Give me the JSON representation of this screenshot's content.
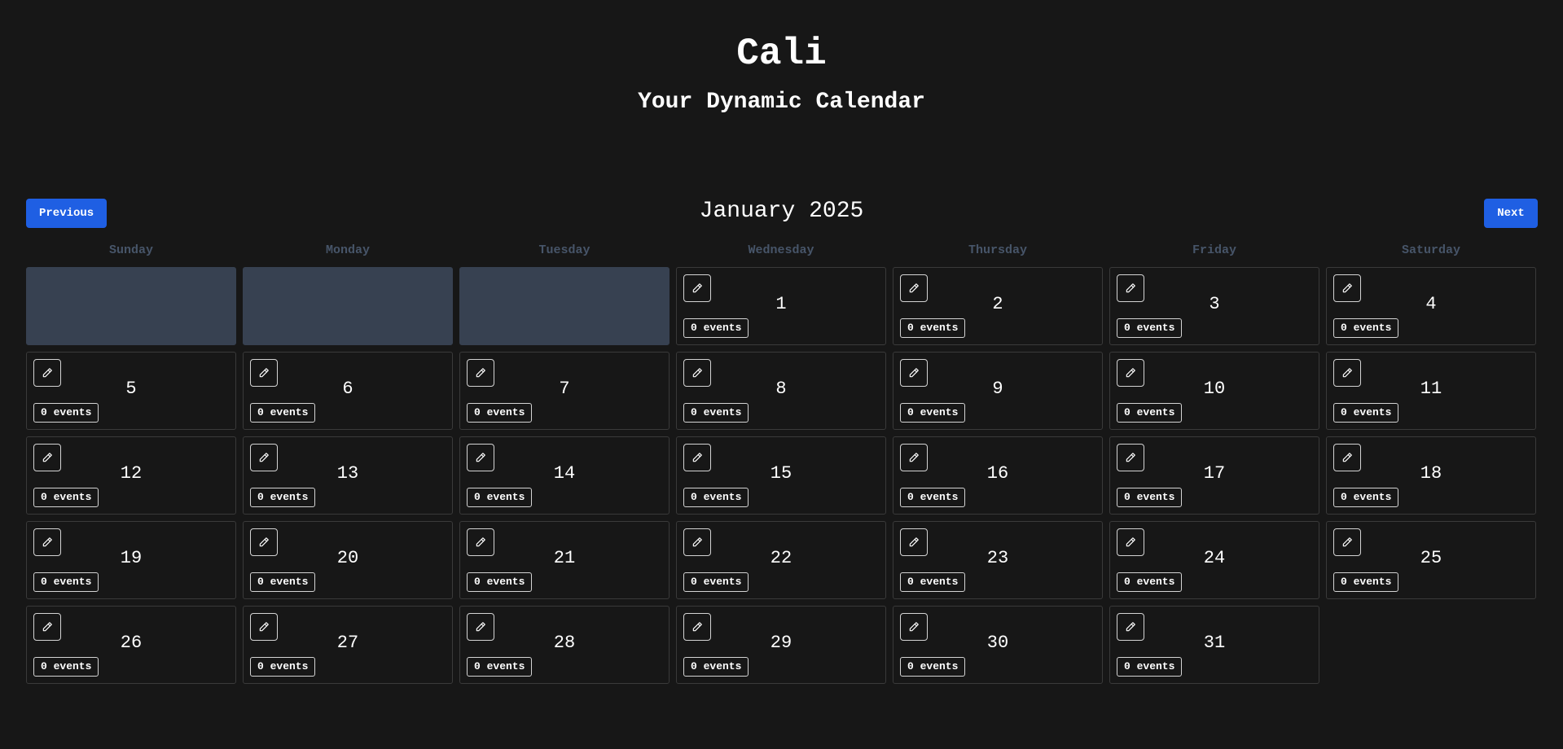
{
  "header": {
    "title": "Cali",
    "subtitle": "Your Dynamic Calendar"
  },
  "nav": {
    "previous_label": "Previous",
    "next_label": "Next",
    "month_title": "January 2025"
  },
  "weekdays": [
    "Sunday",
    "Monday",
    "Tuesday",
    "Wednesday",
    "Thursday",
    "Friday",
    "Saturday"
  ],
  "calendar": {
    "leading_blank_days": 3,
    "days": [
      {
        "day": "1",
        "events": "0 events"
      },
      {
        "day": "2",
        "events": "0 events"
      },
      {
        "day": "3",
        "events": "0 events"
      },
      {
        "day": "4",
        "events": "0 events"
      },
      {
        "day": "5",
        "events": "0 events"
      },
      {
        "day": "6",
        "events": "0 events"
      },
      {
        "day": "7",
        "events": "0 events"
      },
      {
        "day": "8",
        "events": "0 events"
      },
      {
        "day": "9",
        "events": "0 events"
      },
      {
        "day": "10",
        "events": "0 events"
      },
      {
        "day": "11",
        "events": "0 events"
      },
      {
        "day": "12",
        "events": "0 events"
      },
      {
        "day": "13",
        "events": "0 events"
      },
      {
        "day": "14",
        "events": "0 events"
      },
      {
        "day": "15",
        "events": "0 events"
      },
      {
        "day": "16",
        "events": "0 events"
      },
      {
        "day": "17",
        "events": "0 events"
      },
      {
        "day": "18",
        "events": "0 events"
      },
      {
        "day": "19",
        "events": "0 events"
      },
      {
        "day": "20",
        "events": "0 events"
      },
      {
        "day": "21",
        "events": "0 events"
      },
      {
        "day": "22",
        "events": "0 events"
      },
      {
        "day": "23",
        "events": "0 events"
      },
      {
        "day": "24",
        "events": "0 events"
      },
      {
        "day": "25",
        "events": "0 events"
      },
      {
        "day": "26",
        "events": "0 events"
      },
      {
        "day": "27",
        "events": "0 events"
      },
      {
        "day": "28",
        "events": "0 events"
      },
      {
        "day": "29",
        "events": "0 events"
      },
      {
        "day": "30",
        "events": "0 events"
      },
      {
        "day": "31",
        "events": "0 events"
      }
    ],
    "edit_icon": "pencil-icon"
  },
  "colors": {
    "background": "#171717",
    "accent": "#1f5fe3",
    "blank_cell": "#374151",
    "weekday_text": "#475569"
  }
}
